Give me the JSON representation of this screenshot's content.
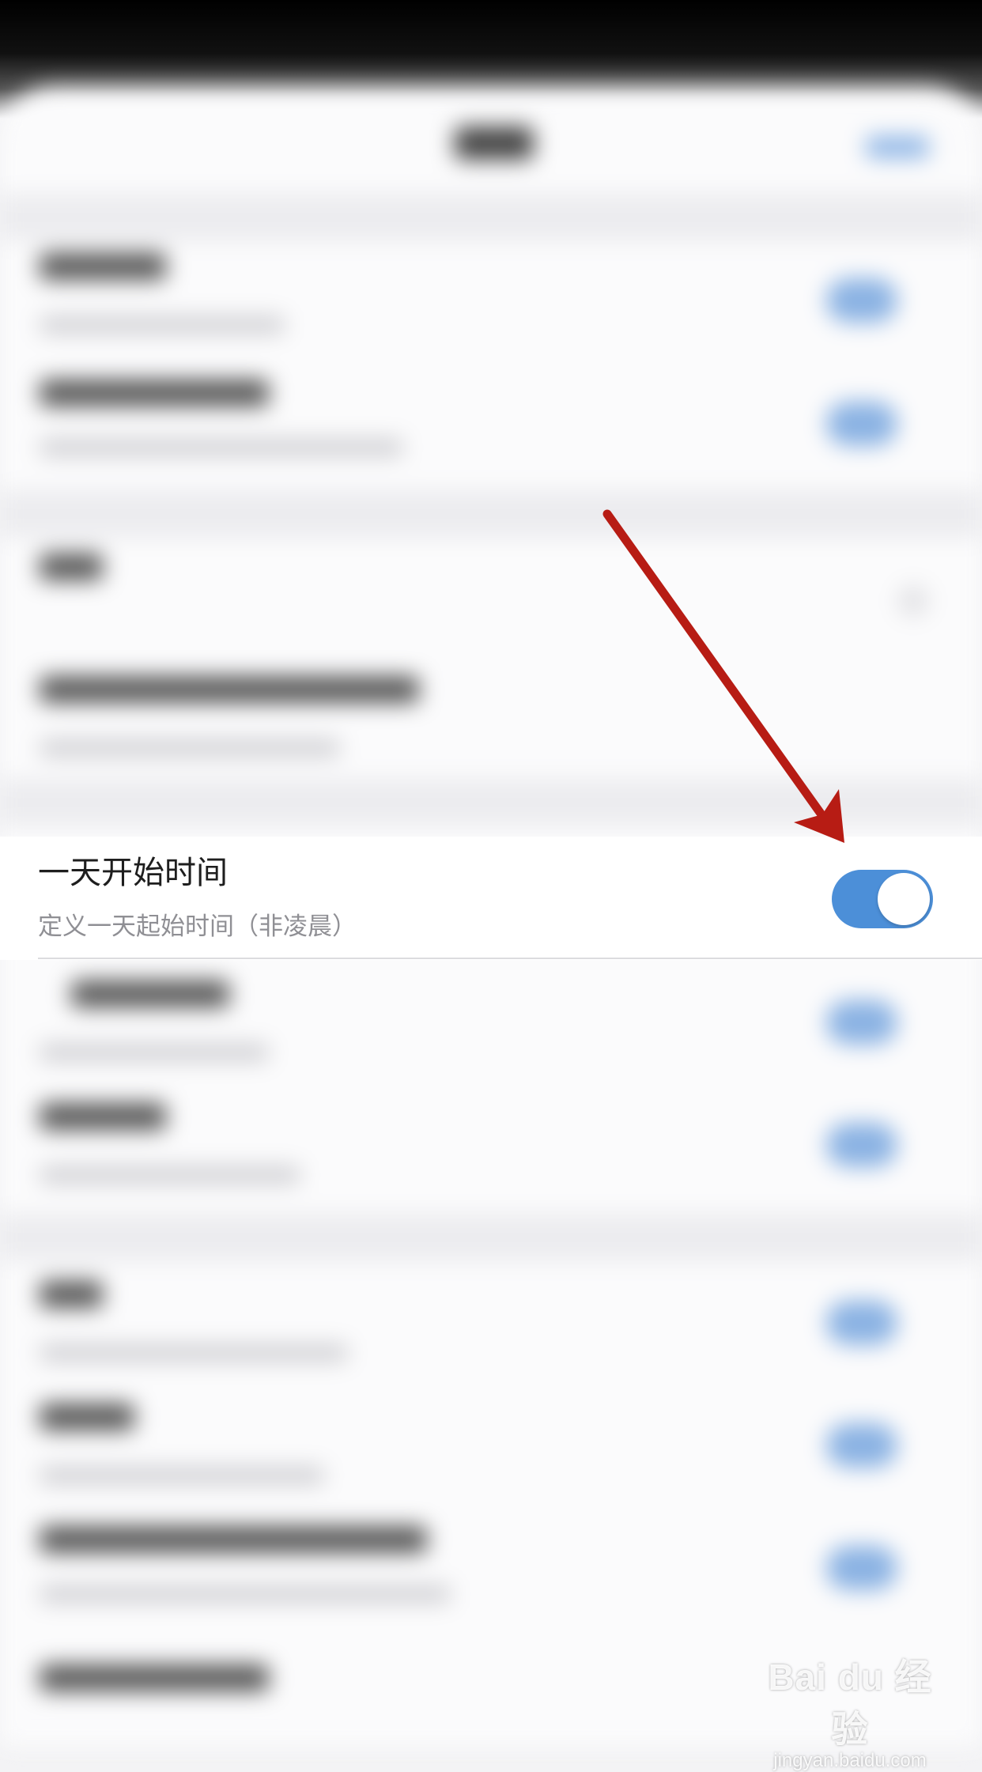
{
  "setting": {
    "title": "一天开始时间",
    "subtitle": "定义一天起始时间（非凌晨）",
    "enabled": true
  },
  "watermark": {
    "brand": "Bai du 经验",
    "url": "jingyan.baidu.com"
  },
  "colors": {
    "toggle_on": "#4c8fd8",
    "annotation_arrow": "#b71c14"
  }
}
